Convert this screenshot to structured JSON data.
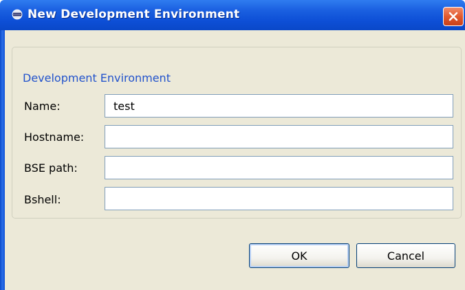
{
  "window": {
    "title": "New Development Environment"
  },
  "icons": {
    "app": "eclipse-icon",
    "close": "close-icon"
  },
  "colors": {
    "titlebar": "#0d4fd6",
    "close_button": "#e25a2e",
    "dialog_background": "#ece9d8",
    "group_label": "#2152cc",
    "input_border": "#7f9db9",
    "button_border": "#003c74"
  },
  "group": {
    "label": "Development Environment",
    "fields": [
      {
        "label": "Name:",
        "value": "test"
      },
      {
        "label": "Hostname:",
        "value": ""
      },
      {
        "label": "BSE path:",
        "value": ""
      },
      {
        "label": "Bshell:",
        "value": ""
      }
    ]
  },
  "buttons": {
    "ok": "OK",
    "cancel": "Cancel"
  }
}
